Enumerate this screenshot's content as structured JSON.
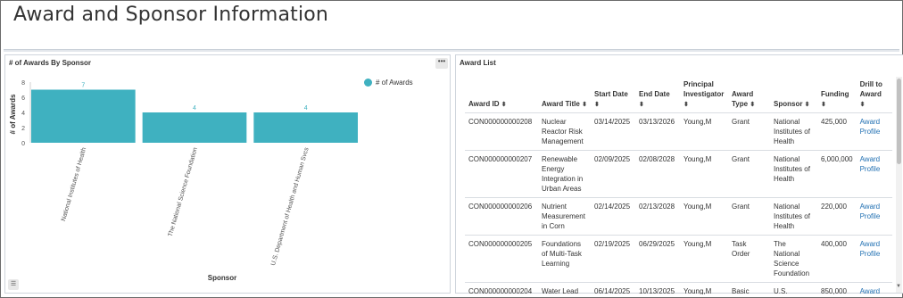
{
  "page": {
    "title": "Award and Sponsor Information"
  },
  "left_panel": {
    "title": "# of Awards By Sponsor",
    "more_icon": "ellipsis-icon",
    "table_toggle_icon": "list-icon",
    "legend_label": "# of Awards",
    "colors": {
      "bar": "#3fb1c0",
      "label": "#3fb1c0"
    }
  },
  "chart_data": {
    "type": "bar",
    "categories": [
      "National Institutes of Health",
      "The National Science Foundation",
      "U.S. Department of Health and Human Svcs"
    ],
    "values": [
      7,
      4,
      4
    ],
    "xlabel": "Sponsor",
    "ylabel": "# of Awards",
    "ylim": [
      0,
      8
    ],
    "yticks": [
      0,
      2,
      4,
      6,
      8
    ],
    "legend": [
      "# of Awards"
    ],
    "legend_position": "top-right",
    "grid": false
  },
  "right_panel": {
    "title": "Award List",
    "columns": [
      {
        "label": "Award ID",
        "sort_icon": "⬍"
      },
      {
        "label": "Award Title",
        "sort_icon": "⬍"
      },
      {
        "label": "Start Date",
        "sort_icon": "⬍"
      },
      {
        "label": "End Date",
        "sort_icon": "⬍"
      },
      {
        "label": "Principal Investigator",
        "sort_icon": "⬍"
      },
      {
        "label": "Award Type",
        "sort_icon": "⬍"
      },
      {
        "label": "Sponsor",
        "sort_icon": "⬍"
      },
      {
        "label": "Funding",
        "sort_icon": "⬍"
      },
      {
        "label": "Drill to Award",
        "sort_icon": "⬍"
      }
    ],
    "rows": [
      [
        "CON000000000208",
        "Nuclear Reactor Risk Management",
        "03/14/2025",
        "03/13/2026",
        "Young,M",
        "Grant",
        "National Institutes of Health",
        "425,000",
        "Award Profile"
      ],
      [
        "CON000000000207",
        "Renewable Energy Integration in Urban Areas",
        "02/09/2025",
        "02/08/2028",
        "Young,M",
        "Grant",
        "National Institutes of Health",
        "6,000,000",
        "Award Profile"
      ],
      [
        "CON000000000206",
        "Nutrient Measurement in Corn",
        "02/14/2025",
        "02/13/2028",
        "Young,M",
        "Grant",
        "National Institutes of Health",
        "220,000",
        "Award Profile"
      ],
      [
        "CON000000000205",
        "Foundations of Multi-Task Learning",
        "02/19/2025",
        "06/29/2025",
        "Young,M",
        "Task Order",
        "The National Science Foundation",
        "400,000",
        "Award Profile"
      ],
      [
        "CON000000000204",
        "Water Lead Study in Rural",
        "06/14/2025",
        "10/13/2025",
        "Young,M",
        "Basic Ordering",
        "U.S. Department",
        "850,000",
        "Award Profile"
      ]
    ]
  }
}
